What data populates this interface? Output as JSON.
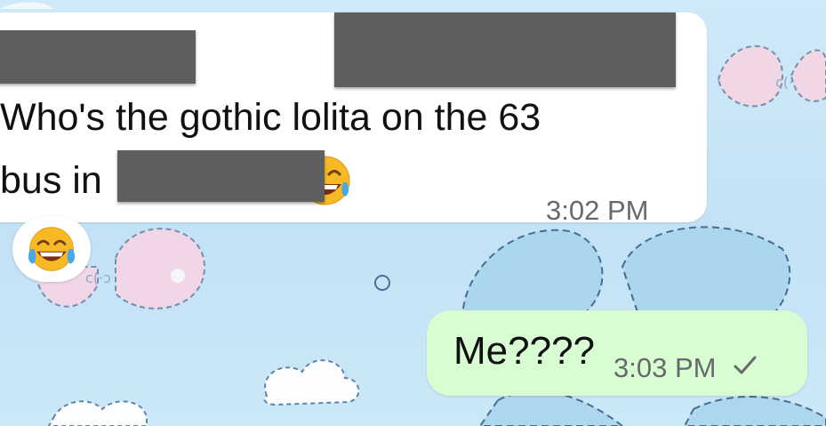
{
  "chat": {
    "incoming": {
      "line1": "Who's the gothic lolita on the 63",
      "line2": "bus in",
      "time": "3:02 PM",
      "inline_emoji": "face-with-tears-of-joy",
      "redactions": 3
    },
    "reaction": {
      "emoji": "face-with-tears-of-joy"
    },
    "outgoing": {
      "text": "Me????",
      "time": "3:03 PM",
      "status_icon": "check-icon"
    }
  },
  "colors": {
    "wallpaper": "#c9e6f6",
    "incoming_bubble": "#ffffff",
    "outgoing_bubble": "#d9fdd3",
    "timestamp": "#666a6c",
    "redaction": "#5f5f5f"
  }
}
